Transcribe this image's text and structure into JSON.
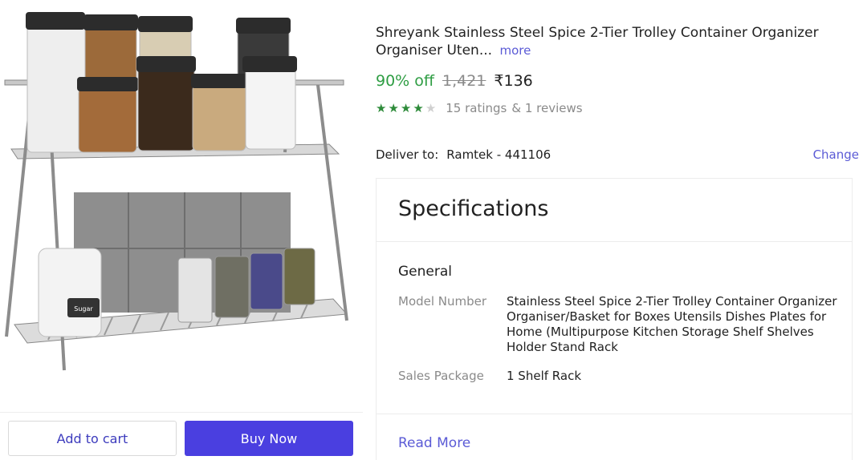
{
  "product": {
    "title": "Shreyank Stainless Steel Spice 2-Tier Trolley Container Organizer Organiser Uten...",
    "more_label": "more",
    "discount": "90% off",
    "mrp": "1,421",
    "price": "₹136",
    "rating_stars": 3.5,
    "ratings_text": "15 ratings",
    "reviews_text": "& 1 reviews",
    "image_label": "Sugar"
  },
  "delivery": {
    "label": "Deliver to:",
    "location": "Ramtek - 441106",
    "change_label": "Change"
  },
  "specifications": {
    "heading": "Specifications",
    "group": "General",
    "rows": [
      {
        "key": "Model Number",
        "value": "Stainless Steel Spice 2-Tier Trolley Container Organizer Organiser/Basket for Boxes Utensils Dishes Plates for Home (Multipurpose Kitchen Storage Shelf Shelves Holder Stand Rack"
      },
      {
        "key": "Sales Package",
        "value": "1 Shelf Rack"
      }
    ],
    "read_more_label": "Read More"
  },
  "actions": {
    "add_to_cart": "Add to cart",
    "buy_now": "Buy Now"
  },
  "colors": {
    "accent": "#4a3fe0",
    "discount": "#2e9d43",
    "link": "#5b5bd6"
  }
}
